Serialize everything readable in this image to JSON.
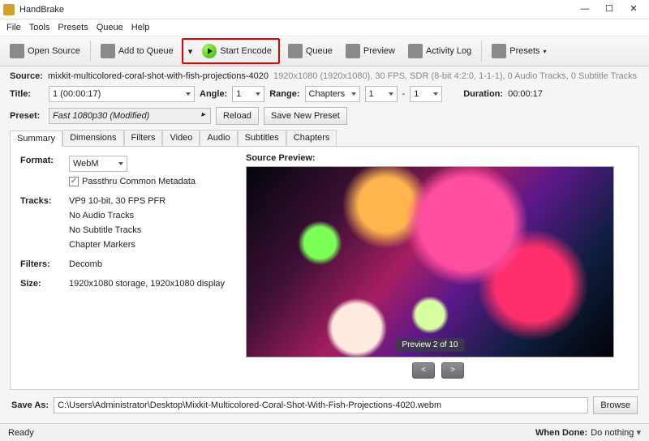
{
  "window": {
    "title": "HandBrake"
  },
  "menu": {
    "file": "File",
    "tools": "Tools",
    "presets": "Presets",
    "queue": "Queue",
    "help": "Help"
  },
  "toolbar": {
    "opensource": "Open Source",
    "addqueue": "Add to Queue",
    "startencode": "Start Encode",
    "queue": "Queue",
    "preview": "Preview",
    "activity": "Activity Log",
    "presets": "Presets"
  },
  "source": {
    "label": "Source:",
    "name": "mixkit-multicolored-coral-shot-with-fish-projections-4020",
    "info": "1920x1080 (1920x1080), 30 FPS, SDR (8-bit 4:2:0, 1-1-1), 0 Audio Tracks, 0 Subtitle Tracks"
  },
  "title": {
    "label": "Title:",
    "value": "1  (00:00:17)"
  },
  "angle": {
    "label": "Angle:",
    "value": "1"
  },
  "range": {
    "label": "Range:",
    "value": "Chapters",
    "from": "1",
    "to": "1",
    "dash": "-"
  },
  "duration": {
    "label": "Duration:",
    "value": "00:00:17"
  },
  "preset": {
    "label": "Preset:",
    "value": "Fast 1080p30   (Modified)",
    "reload": "Reload",
    "savenew": "Save New Preset"
  },
  "tabs": {
    "summary": "Summary",
    "dimensions": "Dimensions",
    "filters": "Filters",
    "video": "Video",
    "audio": "Audio",
    "subtitles": "Subtitles",
    "chapters": "Chapters"
  },
  "summary": {
    "format_label": "Format:",
    "format_value": "WebM",
    "passthru": "Passthru Common Metadata",
    "tracks_label": "Tracks:",
    "tracks1": "VP9 10-bit, 30 FPS PFR",
    "tracks2": "No Audio Tracks",
    "tracks3": "No Subtitle Tracks",
    "tracks4": "Chapter Markers",
    "filters_label": "Filters:",
    "filters_value": "Decomb",
    "size_label": "Size:",
    "size_value": "1920x1080 storage, 1920x1080 display",
    "preview_label": "Source Preview:",
    "preview_badge": "Preview 2 of 10",
    "prev": "<",
    "next": ">"
  },
  "saveas": {
    "label": "Save As:",
    "path": "C:\\Users\\Administrator\\Desktop\\Mixkit-Multicolored-Coral-Shot-With-Fish-Projections-4020.webm",
    "browse": "Browse"
  },
  "status": {
    "ready": "Ready",
    "whendone_label": "When Done:",
    "whendone_value": "Do nothing"
  }
}
